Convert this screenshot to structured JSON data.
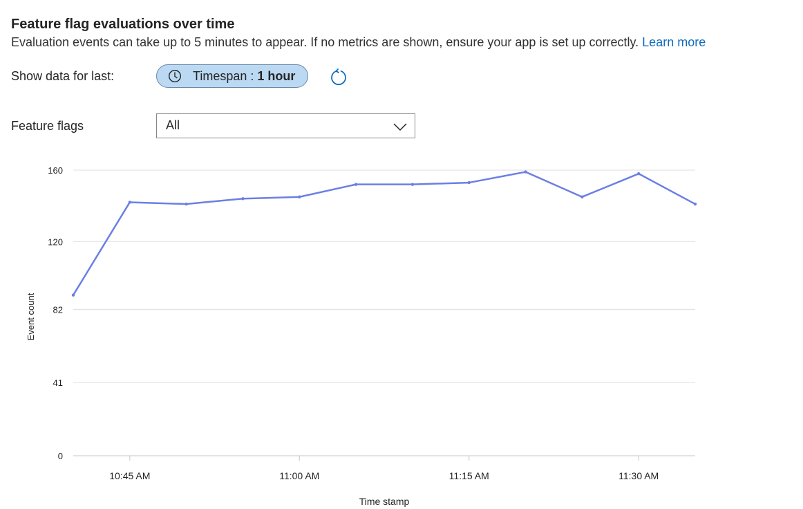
{
  "header": {
    "title": "Feature flag evaluations over time",
    "subtitle": "Evaluation events can take up to 5 minutes to appear. If no metrics are shown, ensure your app is set up correctly.",
    "learn_more": "Learn more"
  },
  "timespan": {
    "label": "Show data for last:",
    "pill_prefix": "Timespan : ",
    "pill_value": "1 hour",
    "icon": "clock-icon",
    "refresh_icon": "refresh-icon"
  },
  "feature_flags": {
    "label": "Feature flags",
    "selected": "All",
    "icon": "chevron-down-icon"
  },
  "colors": {
    "accent": "#0f6cbd",
    "series": "#6b7fe3",
    "pill_bg": "#bbd9f3"
  },
  "chart_data": {
    "type": "line",
    "xlabel": "Time stamp",
    "ylabel": "Event count",
    "yticks": [
      0,
      41,
      82,
      120,
      160
    ],
    "ylim": [
      0,
      160
    ],
    "xlim": [
      "10:40 AM",
      "11:35 AM"
    ],
    "xticks": [
      "10:45 AM",
      "11:00 AM",
      "11:15 AM",
      "11:30 AM"
    ],
    "grid": true,
    "series": [
      {
        "x": [
          "10:40 AM",
          "10:45 AM",
          "10:50 AM",
          "10:55 AM",
          "11:00 AM",
          "11:05 AM",
          "11:10 AM",
          "11:15 AM",
          "11:20 AM",
          "11:25 AM",
          "11:30 AM",
          "11:35 AM"
        ],
        "values": [
          90,
          142,
          141,
          144,
          145,
          152,
          152,
          153,
          159,
          145,
          158,
          141
        ]
      }
    ]
  }
}
